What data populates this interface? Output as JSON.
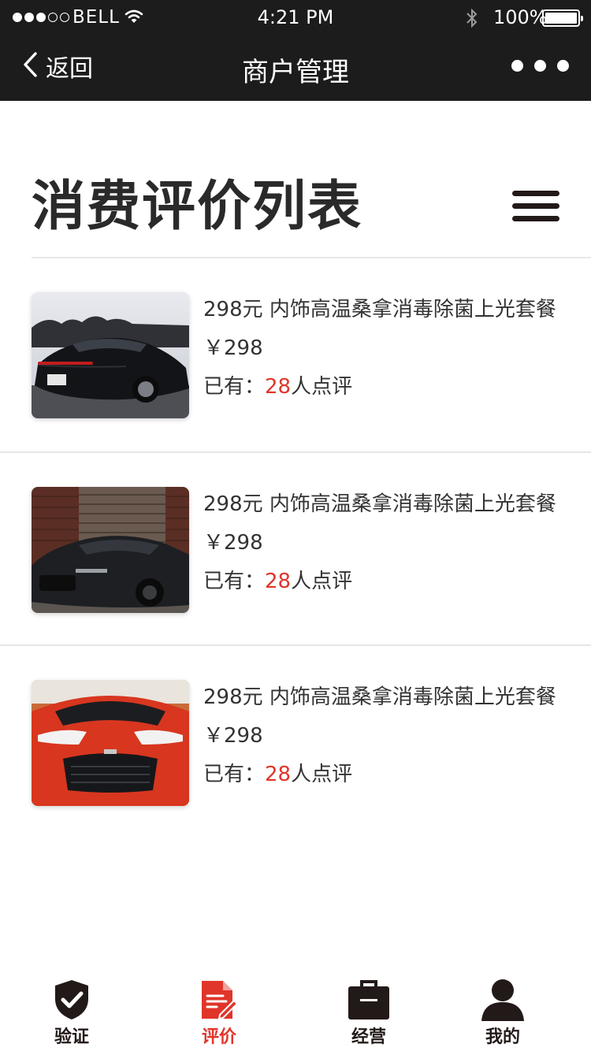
{
  "status_bar": {
    "carrier": "BELL",
    "time": "4:21 PM",
    "battery": "100%"
  },
  "nav": {
    "back_label": "返回",
    "title": "商户管理"
  },
  "page": {
    "heading": "消费评价列表"
  },
  "reviews": [
    {
      "title": "298元 内饰高温桑拿消毒除菌上光套餐",
      "price": "￥298",
      "reviews_prefix": "已有：",
      "reviews_count": "28",
      "reviews_suffix": "人点评",
      "image": "black-porsche-rear-photo"
    },
    {
      "title": "298元 内饰高温桑拿消毒除菌上光套餐",
      "price": "￥298",
      "reviews_prefix": "已有：",
      "reviews_count": "28",
      "reviews_suffix": "人点评",
      "image": "black-audi-brick-wall-photo"
    },
    {
      "title": "298元 内饰高温桑拿消毒除菌上光套餐",
      "price": "￥298",
      "reviews_prefix": "已有：",
      "reviews_count": "28",
      "reviews_suffix": "人点评",
      "image": "red-nissan-gtr-front-photo"
    }
  ],
  "tabbar": {
    "tabs": [
      {
        "label": "验证",
        "icon": "shield-check-icon",
        "active": false
      },
      {
        "label": "评价",
        "icon": "document-edit-icon",
        "active": true
      },
      {
        "label": "经营",
        "icon": "briefcase-icon",
        "active": false
      },
      {
        "label": "我的",
        "icon": "user-icon",
        "active": false
      }
    ]
  },
  "colors": {
    "header_bg": "#1c1c1c",
    "accent_red": "#e0352b",
    "text_dark": "#333333",
    "icon_dark": "#221a18"
  }
}
